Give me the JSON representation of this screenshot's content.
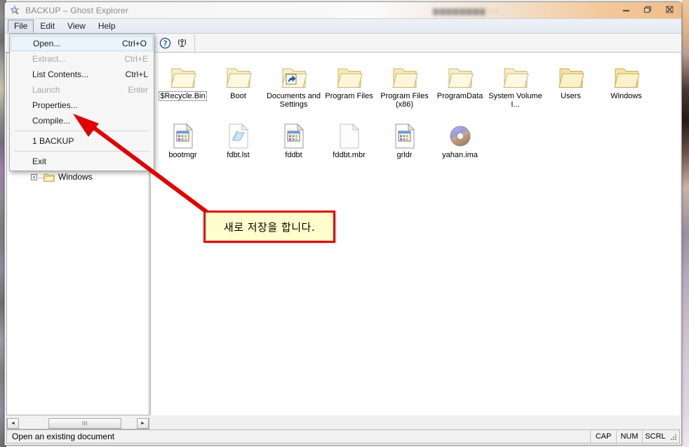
{
  "window": {
    "title": "BACKUP – Ghost Explorer",
    "title_icon": "ghost-explorer-icon",
    "background_window_title": "",
    "controls": {
      "minimize": "Minimize",
      "maximize": "Restore",
      "close": "Close"
    }
  },
  "menubar": {
    "items": [
      {
        "label": "File",
        "open": true
      },
      {
        "label": "Edit",
        "open": false
      },
      {
        "label": "View",
        "open": false
      },
      {
        "label": "Help",
        "open": false
      }
    ]
  },
  "file_menu": {
    "items": [
      {
        "label": "Open...",
        "accel": "Ctrl+O",
        "disabled": false,
        "highlighted": true,
        "separator_after": false
      },
      {
        "label": "Extract...",
        "accel": "Ctrl+E",
        "disabled": true,
        "highlighted": false,
        "separator_after": false
      },
      {
        "label": "List Contents...",
        "accel": "Ctrl+L",
        "disabled": false,
        "highlighted": false,
        "separator_after": false
      },
      {
        "label": "Launch",
        "accel": "Enter",
        "disabled": true,
        "highlighted": false,
        "separator_after": false
      },
      {
        "label": "Properties...",
        "accel": "",
        "disabled": false,
        "highlighted": false,
        "separator_after": false
      },
      {
        "label": "Compile...",
        "accel": "",
        "disabled": false,
        "highlighted": false,
        "separator_after": true
      },
      {
        "label": "1 BACKUP",
        "accel": "",
        "disabled": false,
        "highlighted": false,
        "separator_after": true
      },
      {
        "label": "Exit",
        "accel": "",
        "disabled": false,
        "highlighted": false,
        "separator_after": false
      }
    ]
  },
  "toolbar": {
    "buttons": [
      {
        "icon": "help-question-icon",
        "label": "Help"
      },
      {
        "icon": "about-antenna-icon",
        "label": "About"
      }
    ]
  },
  "tree": {
    "items": [
      {
        "label": "Windows",
        "expander": "+",
        "icon": "folder-icon"
      }
    ],
    "hscroll": {
      "left_arrow": "◄",
      "right_arrow": "►",
      "thumb_glyph": "III"
    }
  },
  "file_list": {
    "rows": [
      [
        {
          "name": "$Recycle.Bin",
          "icon": "folder-icon",
          "selected": true
        },
        {
          "name": "Boot",
          "icon": "folder-icon",
          "selected": false
        },
        {
          "name": "Documents and Settings",
          "icon": "folder-shortcut-icon",
          "selected": false
        },
        {
          "name": "Program Files",
          "icon": "folder-icon",
          "selected": false
        },
        {
          "name": "Program Files (x86)",
          "icon": "folder-icon",
          "selected": false
        },
        {
          "name": "ProgramData",
          "icon": "folder-icon",
          "selected": false
        },
        {
          "name": "System Volume I...",
          "icon": "folder-icon",
          "selected": false
        },
        {
          "name": "Users",
          "icon": "folder-icon",
          "selected": false
        },
        {
          "name": "Windows",
          "icon": "folder-icon",
          "selected": false
        }
      ],
      [
        {
          "name": "bootmgr",
          "icon": "file-app-icon",
          "selected": false
        },
        {
          "name": "fdbt.lst",
          "icon": "file-blue-icon",
          "selected": false
        },
        {
          "name": "fddbt",
          "icon": "file-app-icon",
          "selected": false
        },
        {
          "name": "fddbt.mbr",
          "icon": "file-blank-icon",
          "selected": false
        },
        {
          "name": "grldr",
          "icon": "file-app-icon",
          "selected": false
        },
        {
          "name": "yahan.ima",
          "icon": "disc-icon",
          "selected": false
        }
      ]
    ]
  },
  "statusbar": {
    "message": "Open an existing document",
    "indicators": [
      "CAP",
      "NUM",
      "SCRL"
    ],
    "grip": "resize-grip-icon"
  },
  "annotation": {
    "callout_text": "새로 저장을 합니다.",
    "arrow": "red-arrow-pointer",
    "colors": {
      "callout_bg": "#ffffcc",
      "callout_border": "#e00000",
      "arrow": "#e00000"
    }
  }
}
